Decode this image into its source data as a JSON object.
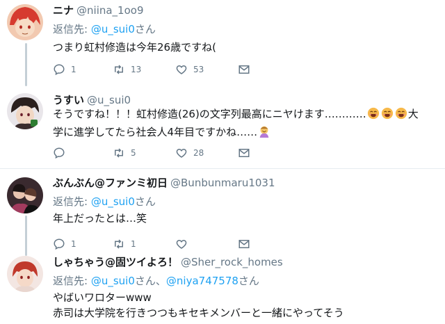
{
  "tweets": [
    {
      "name": "ニナ",
      "handle": "@niina_1oo9",
      "reply_prefix": "返信先:",
      "reply_to": [
        "@u_sui0"
      ],
      "reply_suffix": "さん",
      "text_lines": [
        "つまり虹村修造は今年26歳ですね("
      ],
      "counts": {
        "reply": "1",
        "retweet": "13",
        "like": "53"
      }
    },
    {
      "name": "うすい",
      "handle": "@u_sui0",
      "text_lines": [
        "そうですね！！！虹村修造(26)の文字列最高にニヤけます…………",
        "大",
        "学に進学してたら社会人4年目ですかね……"
      ],
      "counts": {
        "reply": "",
        "retweet": "5",
        "like": "28"
      }
    },
    {
      "name": "ぶんぶん@ファンミ初日",
      "handle": "@Bunbunmaru1031",
      "reply_prefix": "返信先:",
      "reply_to": [
        "@u_sui0"
      ],
      "reply_suffix": "さん",
      "text_lines": [
        "年上だったとは…笑"
      ],
      "counts": {
        "reply": "1",
        "retweet": "1",
        "like": ""
      }
    },
    {
      "name": "しゃちゃう@固ツイよろ！",
      "handle": "@Sher_rock_homes",
      "reply_prefix": "返信先:",
      "reply_to": [
        "@u_sui0",
        "@niya747578"
      ],
      "reply_mid": "さん、",
      "reply_suffix": "さん",
      "text_lines": [
        "やばいワロターwww",
        "赤司は大学院を行きつつもキセキメンバーと一緒にやってそう"
      ]
    }
  ],
  "colors": {
    "accent": "#1da1f2",
    "muted": "#657786",
    "divider": "#e6ecf0",
    "thread": "#c4cfd6"
  },
  "icons": [
    "reply-icon",
    "retweet-icon",
    "like-icon",
    "dm-icon",
    "grinning-emoji-icon",
    "facepalm-emoji-icon"
  ]
}
